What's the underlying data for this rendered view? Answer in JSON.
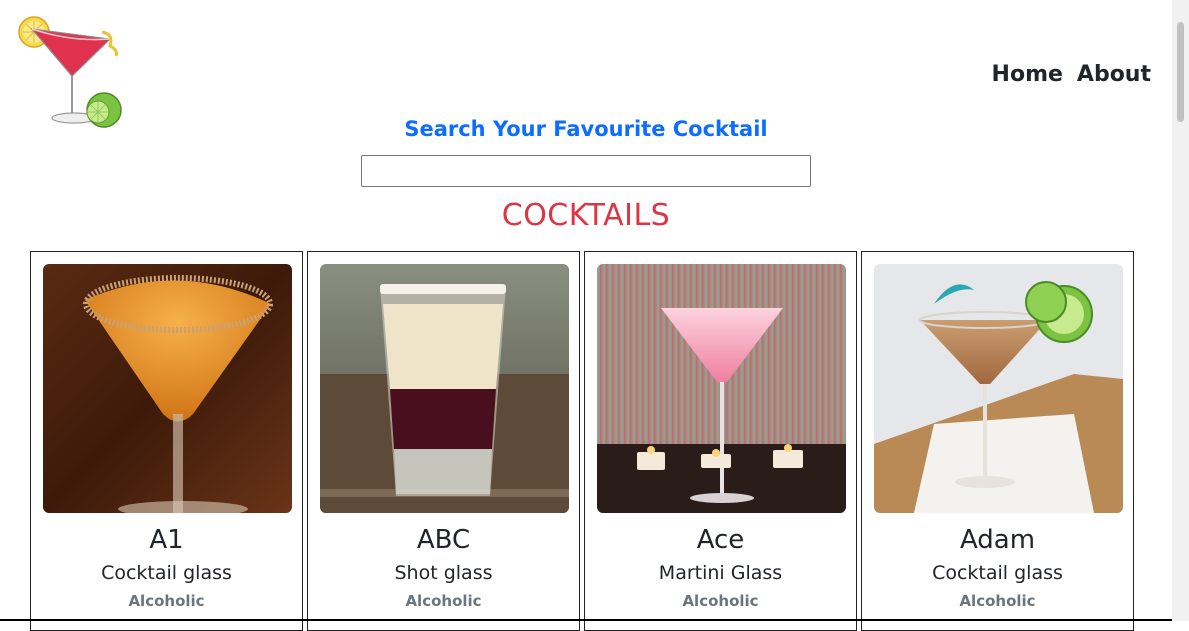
{
  "header": {
    "logo": "cocktail-logo-icon",
    "nav": [
      {
        "label": "Home"
      },
      {
        "label": "About"
      }
    ]
  },
  "search": {
    "title": "Search Your Favourite Cocktail",
    "value": "",
    "placeholder": ""
  },
  "section_title": "COCKTAILS",
  "cocktails": [
    {
      "name": "A1",
      "glass": "Cocktail glass",
      "type": "Alcoholic",
      "image": "orange-martini-photo"
    },
    {
      "name": "ABC",
      "glass": "Shot glass",
      "type": "Alcoholic",
      "image": "layered-shot-photo"
    },
    {
      "name": "Ace",
      "glass": "Martini Glass",
      "type": "Alcoholic",
      "image": "pink-martini-photo"
    },
    {
      "name": "Adam",
      "glass": "Cocktail glass",
      "type": "Alcoholic",
      "image": "amber-martini-lime-photo"
    }
  ],
  "colors": {
    "search_title": "#0d6efd",
    "section_title": "#dc3545",
    "muted": "#6c757d"
  }
}
